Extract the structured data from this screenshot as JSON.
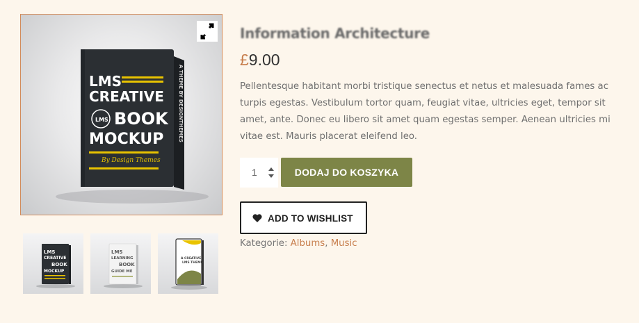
{
  "product": {
    "title": "Information Architecture",
    "currency_symbol": "£",
    "price": "9.00",
    "description": "Pellentesque habitant morbi tristique senectus et netus et malesuada fames ac turpis egestas. Vestibulum tortor quam, feugiat vitae, ultricies eget, tempor sit amet, ante. Donec eu libero sit amet quam egestas semper. Aenean ultricies mi vitae est. Mauris placerat eleifend leo."
  },
  "gallery": {
    "main_cover": {
      "line1": "LMS",
      "line2": "CREATIVE",
      "badge": "LMS",
      "line3": "BOOK",
      "line4": "MOCKUP",
      "byline": "By Design Themes",
      "spine": "A THEME BY DESIGNTHEMES"
    },
    "thumbnails": [
      {
        "line1": "LMS",
        "line2": "CREATIVE",
        "line3": "BOOK",
        "line4": "MOCKUP"
      },
      {
        "line1": "LMS",
        "line2": "LEARNING",
        "line3": "BOOK",
        "line4": "GUIDE ME"
      },
      {
        "line1": "A CREATIVE",
        "line2": "LMS THEME"
      }
    ],
    "zoom_icon": "expand-icon"
  },
  "cart": {
    "quantity": "1",
    "add_to_cart_label": "DODAJ DO KOSZYKA",
    "add_to_wishlist_label": "ADD TO WISHLIST"
  },
  "categories": {
    "label": "Kategorie:",
    "items": [
      "Albums",
      "Music"
    ],
    "separator": ","
  },
  "colors": {
    "background": "#fdf6ec",
    "accent": "#c87f4e",
    "cart_button": "#7d8547",
    "book_dark": "#2b2f33",
    "book_yellow": "#e9c300"
  }
}
